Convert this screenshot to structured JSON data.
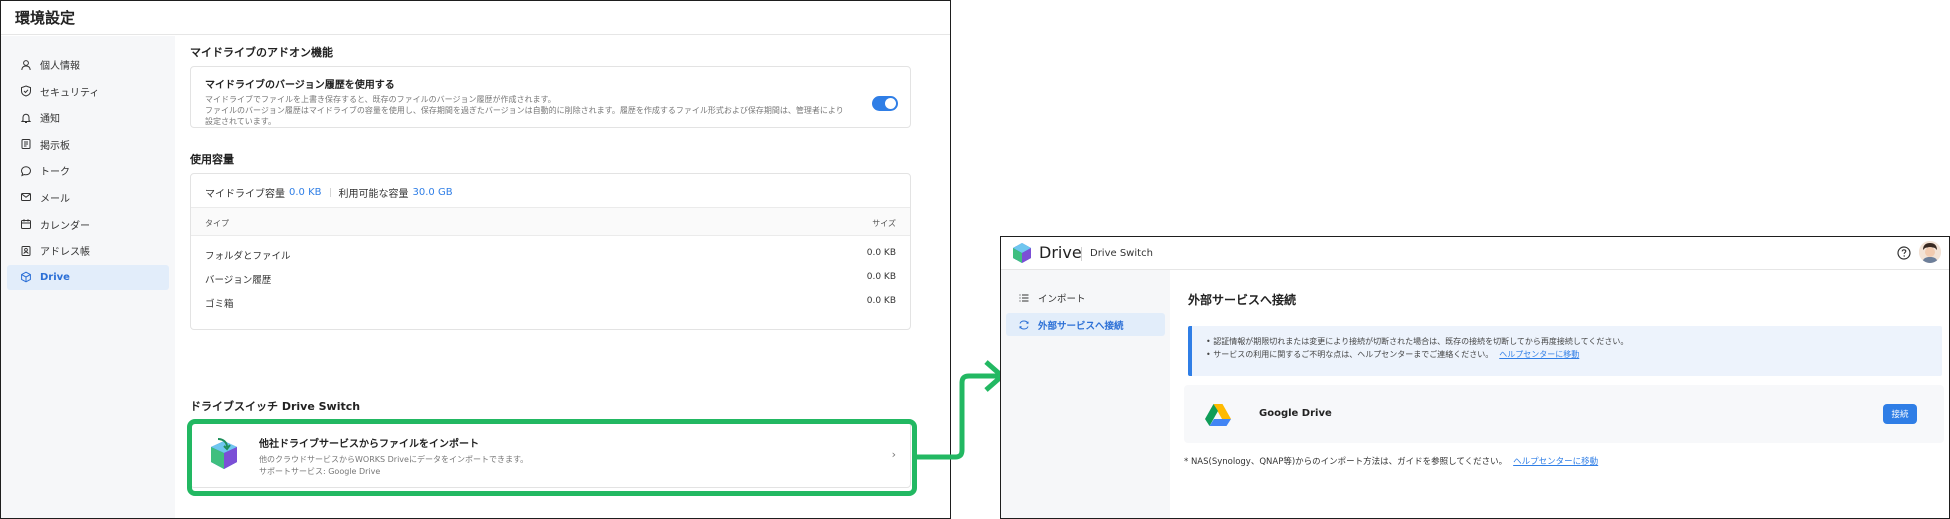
{
  "left_window": {
    "title": "環境設定",
    "sidebar": {
      "items": [
        {
          "label": "個人情報",
          "icon": "person-icon",
          "active": false
        },
        {
          "label": "セキュリティ",
          "icon": "shield-icon",
          "active": false
        },
        {
          "label": "通知",
          "icon": "bell-icon",
          "active": false
        },
        {
          "label": "掲示板",
          "icon": "board-icon",
          "active": false
        },
        {
          "label": "トーク",
          "icon": "chat-icon",
          "active": false
        },
        {
          "label": "メール",
          "icon": "mail-icon",
          "active": false
        },
        {
          "label": "カレンダー",
          "icon": "calendar-icon",
          "active": false
        },
        {
          "label": "アドレス帳",
          "icon": "address-book-icon",
          "active": false
        },
        {
          "label": "Drive",
          "icon": "drive-cube-icon",
          "active": true
        }
      ]
    },
    "addon": {
      "section_title": "マイドライブのアドオン機能",
      "version_title": "マイドライブのバージョン履歴を使用する",
      "version_desc_1": "マイドライブでファイルを上書き保存すると、既存のファイルのバージョン履歴が作成されます。",
      "version_desc_2": "ファイルのバージョン履歴はマイドライブの容量を使用し、保存期間を過ぎたバージョンは自動的に削除されます。履歴を作成するファイル形式および保存期間は、管理者により設定されています。",
      "toggle_on": true
    },
    "usage": {
      "section_title": "使用容量",
      "mydrive_label": "マイドライブ容量",
      "mydrive_value": "0.0 KB",
      "available_label": "利用可能な容量",
      "available_value": "30.0 GB",
      "col_type": "タイプ",
      "col_size": "サイズ",
      "rows": [
        {
          "type": "フォルダとファイル",
          "size": "0.0 KB"
        },
        {
          "type": "バージョン履歴",
          "size": "0.0 KB"
        },
        {
          "type": "ゴミ箱",
          "size": "0.0 KB"
        }
      ]
    },
    "drive_switch": {
      "section_title": "ドライブスイッチ Drive Switch",
      "import_title": "他社ドライブサービスからファイルをインポート",
      "import_desc_1": "他のクラウドサービスからWORKS Driveにデータをインポートできます。",
      "import_desc_2": "サポートサービス: Google Drive"
    }
  },
  "right_window": {
    "brand": "Drive",
    "subtitle": "Drive Switch",
    "sidebar": {
      "items": [
        {
          "label": "インポート",
          "icon": "list-icon",
          "active": false
        },
        {
          "label": "外部サービスへ接続",
          "icon": "sync-icon",
          "active": true
        }
      ]
    },
    "heading": "外部サービスへ接続",
    "info_line_1": "• 認証情報が期限切れまたは変更により接続が切断された場合は、既存の接続を切断してから再度接続してください。",
    "info_line_2": "• サービスの利用に関するご不明な点は、ヘルプセンターまでご連絡ください。",
    "info_link": "ヘルプセンターに移動",
    "service_name": "Google Drive",
    "connect_button": "接続",
    "nas_note": "* NAS(Synology、QNAP等)からのインポート方法は、ガイドを参照してください。",
    "nas_link": "ヘルプセンターに移動"
  },
  "colors": {
    "accent": "#2f7ee6",
    "highlight": "#22b862",
    "active_nav_bg": "#e2edfa"
  }
}
